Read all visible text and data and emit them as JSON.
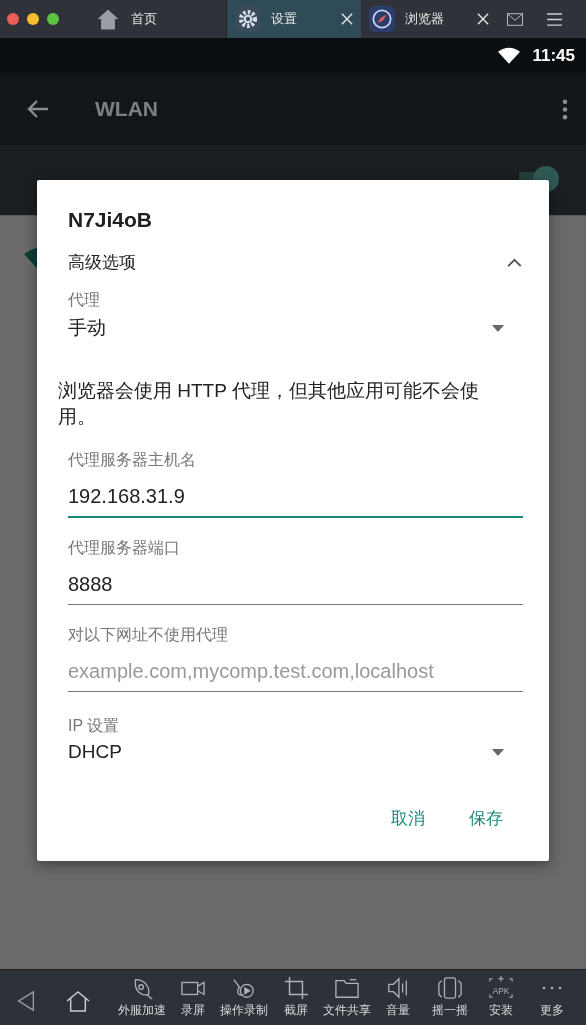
{
  "window_tabs": [
    {
      "label": "首页",
      "kind": "home",
      "selected": false,
      "closable": false
    },
    {
      "label": "设置",
      "kind": "gear",
      "selected": true,
      "closable": true
    },
    {
      "label": "浏览器",
      "kind": "compass",
      "selected": false,
      "closable": true
    }
  ],
  "status_bar": {
    "time": "11:45"
  },
  "app_bar": {
    "title": "WLAN"
  },
  "wlan_switch": {
    "on": true
  },
  "dialog": {
    "title": "N7Ji4oB",
    "advanced": {
      "label": "高级选项",
      "expanded": true
    },
    "proxy": {
      "label": "代理",
      "value": "手动"
    },
    "note": "浏览器会使用 HTTP 代理，但其他应用可能不会使用。",
    "fields": [
      {
        "label": "代理服务器主机名",
        "value": "192.168.31.9",
        "focused": true
      },
      {
        "label": "代理服务器端口",
        "value": "8888",
        "focused": false
      },
      {
        "label": "对以下网址不使用代理",
        "placeholder": "example.com,mycomp.test.com,localhost",
        "focused": false
      }
    ],
    "ip_settings": {
      "label": "IP 设置",
      "value": "DHCP"
    },
    "buttons": [
      "取消",
      "保存"
    ]
  },
  "toolbar": [
    {
      "label": "外服加速",
      "kind": "rocket"
    },
    {
      "label": "录屏",
      "kind": "camera"
    },
    {
      "label": "操作录制",
      "kind": "record"
    },
    {
      "label": "截屏",
      "kind": "crop"
    },
    {
      "label": "文件共享",
      "kind": "folder"
    },
    {
      "label": "音量",
      "kind": "speaker"
    },
    {
      "label": "摇一摇",
      "kind": "phone"
    },
    {
      "label": "安装",
      "kind": "apk",
      "icon_text": "APK"
    },
    {
      "label": "更多",
      "kind": "more"
    }
  ]
}
